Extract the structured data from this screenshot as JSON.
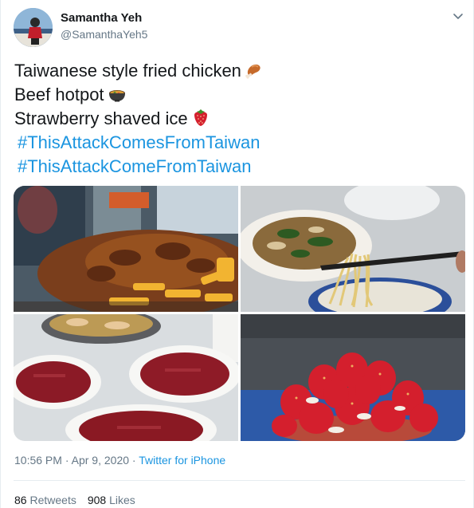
{
  "author": {
    "name": "Samantha Yeh",
    "handle": "@SamanthaYeh5"
  },
  "tweet": {
    "lines": [
      {
        "text": "Taiwanese style fried chicken",
        "emoji": "poultry-leg-icon"
      },
      {
        "text": "Beef hotpot",
        "emoji": "stew-bowl-icon"
      },
      {
        "text": "Strawberry shaved ice",
        "emoji": "strawberry-icon"
      }
    ],
    "hashtags": [
      "#ThisAttackComesFromTaiwan",
      "#ThisAttackComeFromTaiwan"
    ]
  },
  "media": [
    {
      "subject": "fried chicken at night market stall"
    },
    {
      "subject": "noodles lifted with chopsticks"
    },
    {
      "subject": "hotpot with plates of raw beef"
    },
    {
      "subject": "strawberry shaved ice"
    }
  ],
  "meta": {
    "time": "10:56 PM",
    "separator": "·",
    "date": "Apr 9, 2020",
    "source": "Twitter for iPhone"
  },
  "stats": {
    "retweets_count": "86",
    "retweets_label": "Retweets",
    "likes_count": "908",
    "likes_label": "Likes"
  },
  "colors": {
    "link": "#1b95e0",
    "secondary_text": "#657786",
    "primary_text": "#14171a",
    "divider": "#e6ecf0"
  }
}
